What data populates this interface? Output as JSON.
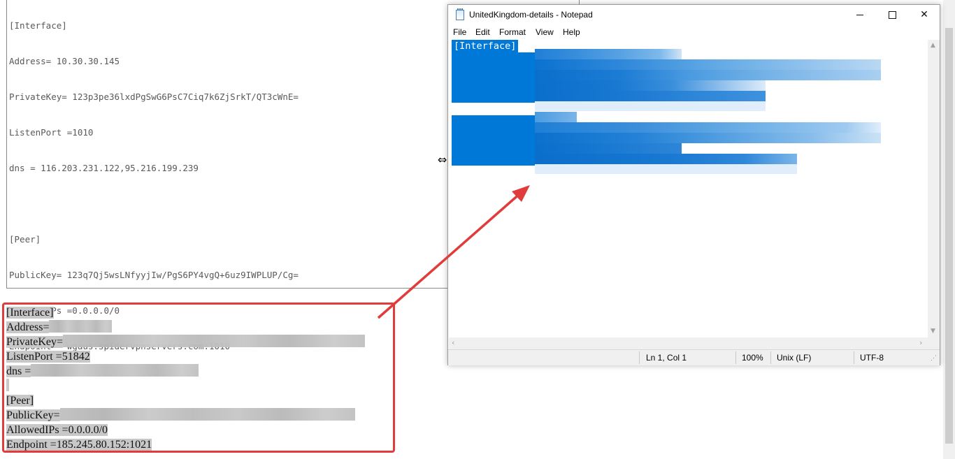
{
  "background_editor": {
    "lines": [
      "[Interface]",
      "Address= 10.30.30.145",
      "PrivateKey= 123p3pe36lxdPgSwG6PsC7Ciq7k6ZjSrkT/QT3cWnE=",
      "ListenPort =1010",
      "dns = 116.203.231.122,95.216.199.239",
      "",
      "[Peer]",
      "PublicKey= 123q7Qj5wsLNfyyjIw/PgS6PY4vgQ+6uz9IWPLUP/Cg=",
      "AllowedIPs =0.0.0.0/0",
      "Endpoint = wgaus.spidervpnservers.com:1010"
    ]
  },
  "pasted_block": {
    "interface_header": "[Interface]",
    "address_label": "Address=",
    "privatekey_label": "PrivateKey=",
    "listenport_line": "ListenPort =51842",
    "dns_label": "dns =",
    "peer_header": "[Peer]",
    "publickey_label": "PublicKey=",
    "allowedips_line": "AllowedIPs =0.0.0.0/0",
    "endpoint_line": "Endpoint =185.245.80.152:1021"
  },
  "notepad": {
    "title": "UnitedKingdom-details - Notepad",
    "menu": [
      "File",
      "Edit",
      "Format",
      "View",
      "Help"
    ],
    "selected_first_line": "[Interface]",
    "status": {
      "position": "Ln 1, Col 1",
      "zoom": "100%",
      "line_ending": "Unix (LF)",
      "encoding": "UTF-8"
    }
  },
  "colors": {
    "selection": "#0078d7",
    "annotation": "#e03c3c"
  }
}
